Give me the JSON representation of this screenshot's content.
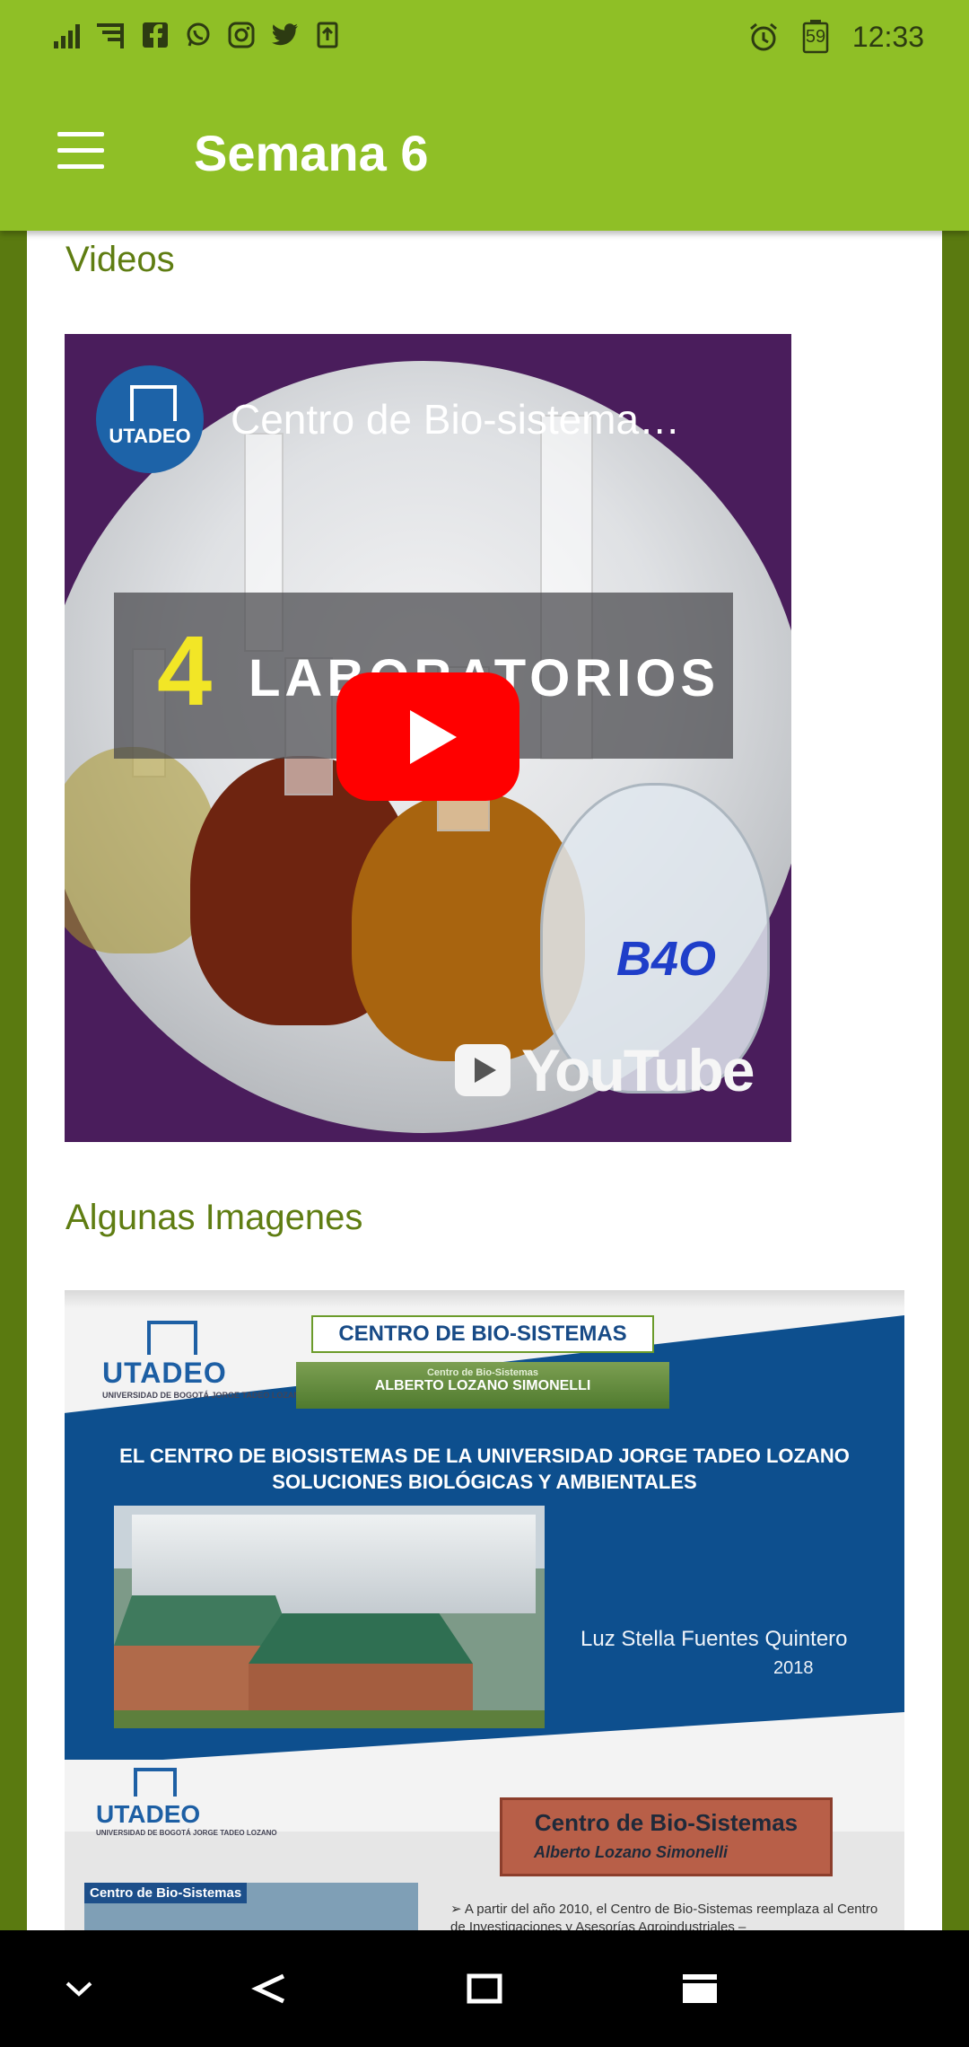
{
  "status_bar": {
    "time": "12:33",
    "battery_level": "59",
    "left_icons": [
      "signal-icon",
      "sim-signal-icon",
      "facebook-icon",
      "whatsapp-icon",
      "instagram-icon",
      "twitter-icon",
      "upload-icon"
    ],
    "right_icons": [
      "alarm-icon",
      "battery-icon"
    ]
  },
  "app_bar": {
    "title": "Semana 6",
    "color": "#8fbf26"
  },
  "sections": {
    "videos_heading": "Videos",
    "images_heading": "Algunas Imagenes"
  },
  "video": {
    "title": "Centro de Bio-sistema…",
    "channel_logo": "UTADEO",
    "overlay_number": "4",
    "overlay_word": "LABORATORIOS",
    "flask_label": "B4O",
    "platform": "YouTube"
  },
  "slide": {
    "logo": "UTADEO",
    "logo_sub": "UNIVERSIDAD DE BOGOTÁ JORGE TADEO LOZANO",
    "box_title": "CENTRO DE BIO-SISTEMAS",
    "banner_small": "Centro de Bio-Sistemas",
    "banner_name": "ALBERTO LOZANO SIMONELLI",
    "heading_line1": "EL CENTRO DE BIOSISTEMAS DE LA UNIVERSIDAD JORGE TADEO LOZANO",
    "heading_line2": "SOLUCIONES BIOLÓGICAS Y AMBIENTALES",
    "author": "Luz Stella Fuentes Quintero",
    "year": "2018",
    "second_logo": "UTADEO",
    "brick_line1": "Centro de Bio-Sistemas",
    "brick_line2": "Alberto Lozano Simonelli",
    "thumb_label": "Centro de Bio-Sistemas",
    "bullet_text": "➢  A partir del año 2010, el Centro de Bio-Sistemas reemplaza al Centro de Investigaciones y Asesorías Agroindustriales –"
  },
  "nav_bar": {
    "buttons": [
      "chevron-down-icon",
      "back-icon",
      "home-icon",
      "recents-icon"
    ]
  }
}
